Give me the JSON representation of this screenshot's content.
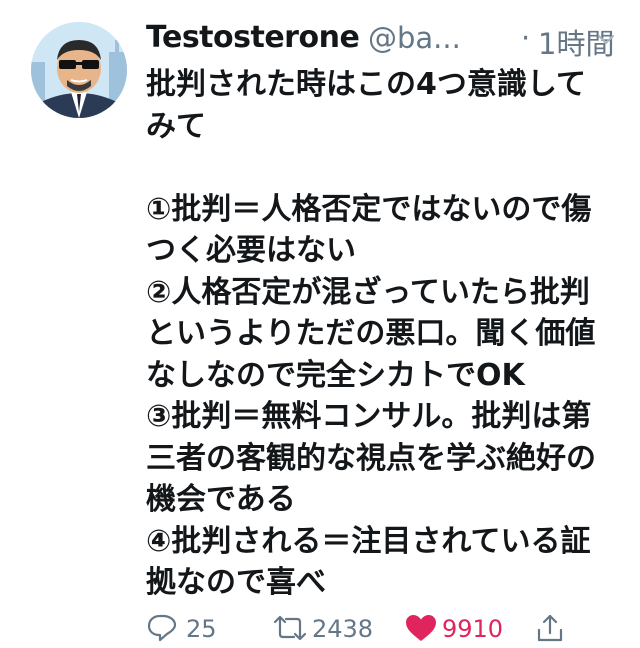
{
  "tweet": {
    "display_name": "Testosterone",
    "handle": "@ba...",
    "separator": "·",
    "time": "1時間",
    "text": "批判された時はこの4つ意識してみて\n\n①批判＝人格否定ではないので傷つく必要はない\n②人格否定が混ざっていたら批判というよりただの悪口。聞く価値なしなので完全シカトでOK\n③批判＝無料コンサル。批判は第三者の客観的な視点を学ぶ絶好の機会である\n④批判される＝注目されている証拠なので喜べ"
  },
  "actions": {
    "reply_count": "25",
    "retweet_count": "2438",
    "like_count": "9910",
    "like_color": "#e0245e",
    "muted_color": "#657786"
  },
  "icons": {
    "avatar": "avatar-image",
    "caret": "chevron-down-icon",
    "reply": "reply-icon",
    "retweet": "retweet-icon",
    "like": "heart-icon",
    "share": "share-icon"
  }
}
